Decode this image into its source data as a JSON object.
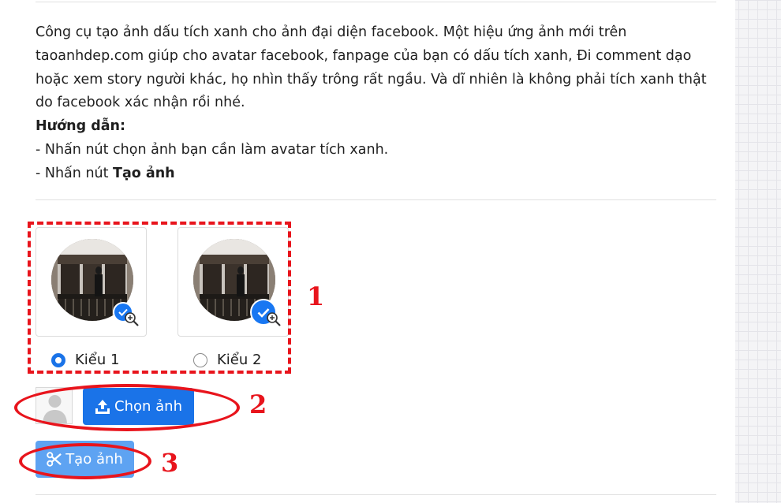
{
  "intro": {
    "line1": "Công cụ tạo ảnh dấu tích xanh cho ảnh đại diện facebook. Một hiệu ứng ảnh mới trên",
    "line2": "taoanhdep.com giúp cho avatar facebook, fanpage của bạn có dấu tích xanh, Đi comment dạo",
    "line3": "hoặc xem story người khác, họ nhìn thấy trông rất ngầu. Và dĩ nhiên là không phải tích xanh thật",
    "line4": "do facebook xác nhận rồi nhé.",
    "guide_heading": "Hướng dẫn:",
    "step1": "- Nhấn nút chọn ảnh bạn cần làm avatar tích xanh.",
    "step2_prefix": "- Nhấn nút ",
    "step2_bold": "Tạo ảnh"
  },
  "styles": [
    {
      "label": "Kiểu 1",
      "selected": true,
      "badge_style": "small"
    },
    {
      "label": "Kiểu 2",
      "selected": false,
      "badge_style": "large"
    }
  ],
  "buttons": {
    "choose_image": "Chọn ảnh",
    "create_image": "Tạo ảnh",
    "choose_icon": "upload-icon",
    "create_icon": "scissors-icon"
  },
  "annotations": {
    "n1": "1",
    "n2": "2",
    "n3": "3"
  },
  "colors": {
    "primary": "#1a73e8",
    "primary_light": "#5ea3f2",
    "annotation_red": "#e8141c",
    "badge_blue": "#1877f2"
  }
}
